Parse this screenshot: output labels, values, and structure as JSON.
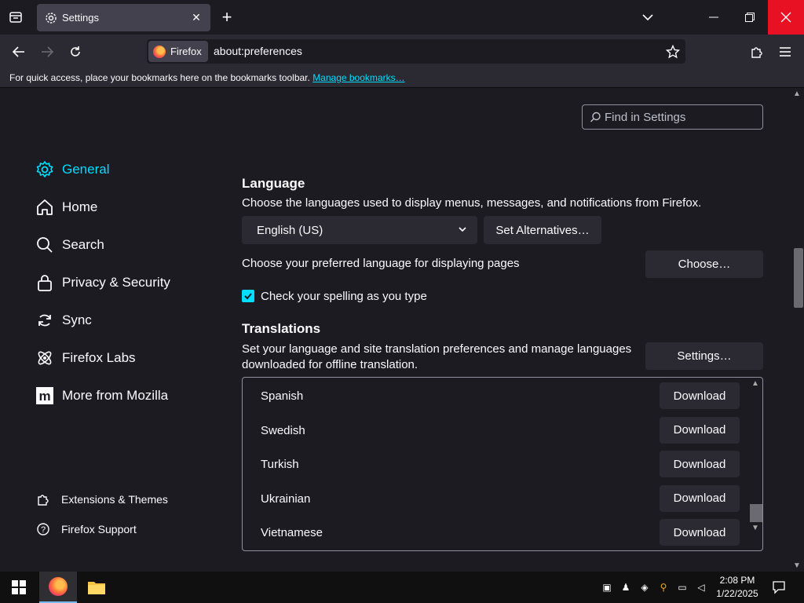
{
  "tab": {
    "title": "Settings"
  },
  "nav": {
    "identity_label": "Firefox",
    "url": "about:preferences"
  },
  "bookmarks_bar": {
    "text": "For quick access, place your bookmarks here on the bookmarks toolbar. ",
    "link": "Manage bookmarks…"
  },
  "search": {
    "placeholder": "Find in Settings"
  },
  "sidebar": {
    "items": [
      {
        "label": "General",
        "icon": "gear-icon"
      },
      {
        "label": "Home",
        "icon": "home-icon"
      },
      {
        "label": "Search",
        "icon": "search-icon"
      },
      {
        "label": "Privacy & Security",
        "icon": "lock-icon"
      },
      {
        "label": "Sync",
        "icon": "sync-icon"
      },
      {
        "label": "Firefox Labs",
        "icon": "flask-icon"
      },
      {
        "label": "More from Mozilla",
        "icon": "mozilla-icon"
      }
    ],
    "footer": [
      {
        "label": "Extensions & Themes",
        "icon": "puzzle-icon"
      },
      {
        "label": "Firefox Support",
        "icon": "help-icon"
      }
    ]
  },
  "language": {
    "heading": "Language",
    "description": "Choose the languages used to display menus, messages, and notifications from Firefox.",
    "selected_language": "English (US)",
    "set_alternatives": "Set Alternatives…",
    "pages_label": "Choose your preferred language for displaying pages",
    "choose_button": "Choose…",
    "spellcheck_label": "Check your spelling as you type",
    "spellcheck_checked": true
  },
  "translations": {
    "heading": "Translations",
    "description": "Set your language and site translation preferences and manage languages downloaded for offline translation.",
    "settings_button": "Settings…",
    "languages": [
      {
        "name": "Spanish",
        "action": "Download"
      },
      {
        "name": "Swedish",
        "action": "Download"
      },
      {
        "name": "Turkish",
        "action": "Download"
      },
      {
        "name": "Ukrainian",
        "action": "Download"
      },
      {
        "name": "Vietnamese",
        "action": "Download"
      }
    ]
  },
  "taskbar": {
    "time": "2:08 PM",
    "date": "1/22/2025"
  },
  "colors": {
    "accent": "#00ddff",
    "background": "#1c1b22",
    "button": "#2b2a33",
    "close": "#e81123"
  }
}
